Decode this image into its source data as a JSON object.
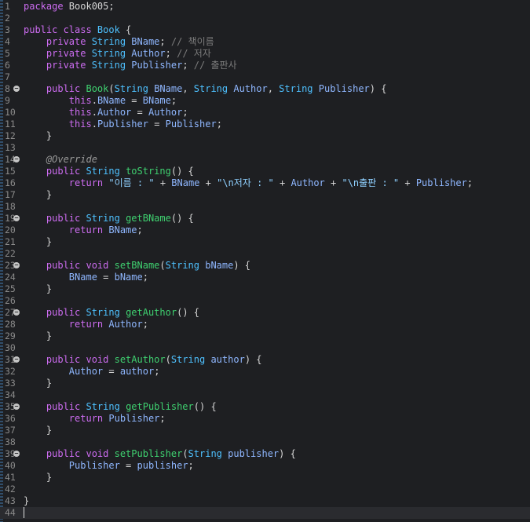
{
  "editor": {
    "lines": [
      {
        "n": "1",
        "fold": false,
        "tokens": [
          [
            "kw",
            "package "
          ],
          [
            "pl",
            "Book005;"
          ]
        ]
      },
      {
        "n": "2",
        "fold": false,
        "tokens": []
      },
      {
        "n": "3",
        "fold": false,
        "tokens": [
          [
            "kw",
            "public class "
          ],
          [
            "typ",
            "Book"
          ],
          [
            "pl",
            " {"
          ]
        ]
      },
      {
        "n": "4",
        "fold": false,
        "tokens": [
          [
            "pl",
            "    "
          ],
          [
            "kw",
            "private "
          ],
          [
            "typ",
            "String "
          ],
          [
            "fld",
            "BName"
          ],
          [
            "pl",
            "; "
          ],
          [
            "cmt",
            "// 책이름"
          ]
        ]
      },
      {
        "n": "5",
        "fold": false,
        "tokens": [
          [
            "pl",
            "    "
          ],
          [
            "kw",
            "private "
          ],
          [
            "typ",
            "String "
          ],
          [
            "fld",
            "Author"
          ],
          [
            "pl",
            "; "
          ],
          [
            "cmt",
            "// 저자"
          ]
        ]
      },
      {
        "n": "6",
        "fold": false,
        "tokens": [
          [
            "pl",
            "    "
          ],
          [
            "kw",
            "private "
          ],
          [
            "typ",
            "String "
          ],
          [
            "fld",
            "Publisher"
          ],
          [
            "pl",
            "; "
          ],
          [
            "cmt",
            "// 출판사"
          ]
        ]
      },
      {
        "n": "7",
        "fold": false,
        "tokens": []
      },
      {
        "n": "8",
        "fold": true,
        "tokens": [
          [
            "pl",
            "    "
          ],
          [
            "kw",
            "public "
          ],
          [
            "fn",
            "Book"
          ],
          [
            "pl",
            "("
          ],
          [
            "typ",
            "String "
          ],
          [
            "fld",
            "BName"
          ],
          [
            "pl",
            ", "
          ],
          [
            "typ",
            "String "
          ],
          [
            "fld",
            "Author"
          ],
          [
            "pl",
            ", "
          ],
          [
            "typ",
            "String "
          ],
          [
            "fld",
            "Publisher"
          ],
          [
            "pl",
            ") {"
          ]
        ]
      },
      {
        "n": "9",
        "fold": false,
        "tokens": [
          [
            "pl",
            "        "
          ],
          [
            "kw",
            "this"
          ],
          [
            "pl",
            "."
          ],
          [
            "fld",
            "BName"
          ],
          [
            "pl",
            " = "
          ],
          [
            "fld",
            "BName"
          ],
          [
            "pl",
            ";"
          ]
        ]
      },
      {
        "n": "10",
        "fold": false,
        "tokens": [
          [
            "pl",
            "        "
          ],
          [
            "kw",
            "this"
          ],
          [
            "pl",
            "."
          ],
          [
            "fld",
            "Author"
          ],
          [
            "pl",
            " = "
          ],
          [
            "fld",
            "Author"
          ],
          [
            "pl",
            ";"
          ]
        ]
      },
      {
        "n": "11",
        "fold": false,
        "tokens": [
          [
            "pl",
            "        "
          ],
          [
            "kw",
            "this"
          ],
          [
            "pl",
            "."
          ],
          [
            "fld",
            "Publisher"
          ],
          [
            "pl",
            " = "
          ],
          [
            "fld",
            "Publisher"
          ],
          [
            "pl",
            ";"
          ]
        ]
      },
      {
        "n": "12",
        "fold": false,
        "tokens": [
          [
            "pl",
            "    }"
          ]
        ]
      },
      {
        "n": "13",
        "fold": false,
        "tokens": []
      },
      {
        "n": "14",
        "fold": true,
        "tokens": [
          [
            "pl",
            "    "
          ],
          [
            "ann",
            "@Override"
          ]
        ]
      },
      {
        "n": "15",
        "fold": false,
        "tokens": [
          [
            "pl",
            "    "
          ],
          [
            "kw",
            "public "
          ],
          [
            "typ",
            "String "
          ],
          [
            "fn",
            "toString"
          ],
          [
            "pl",
            "() {"
          ]
        ]
      },
      {
        "n": "16",
        "fold": false,
        "tokens": [
          [
            "pl",
            "        "
          ],
          [
            "kw",
            "return "
          ],
          [
            "str",
            "\"이름 : \""
          ],
          [
            "pl",
            " + "
          ],
          [
            "fld",
            "BName"
          ],
          [
            "pl",
            " + "
          ],
          [
            "str",
            "\"\\n저자 : \""
          ],
          [
            "pl",
            " + "
          ],
          [
            "fld",
            "Author"
          ],
          [
            "pl",
            " + "
          ],
          [
            "str",
            "\"\\n출판 : \""
          ],
          [
            "pl",
            " + "
          ],
          [
            "fld",
            "Publisher"
          ],
          [
            "pl",
            ";"
          ]
        ]
      },
      {
        "n": "17",
        "fold": false,
        "tokens": [
          [
            "pl",
            "    }"
          ]
        ]
      },
      {
        "n": "18",
        "fold": false,
        "tokens": []
      },
      {
        "n": "19",
        "fold": true,
        "tokens": [
          [
            "pl",
            "    "
          ],
          [
            "kw",
            "public "
          ],
          [
            "typ",
            "String "
          ],
          [
            "fn",
            "getBName"
          ],
          [
            "pl",
            "() {"
          ]
        ]
      },
      {
        "n": "20",
        "fold": false,
        "tokens": [
          [
            "pl",
            "        "
          ],
          [
            "kw",
            "return "
          ],
          [
            "fld",
            "BName"
          ],
          [
            "pl",
            ";"
          ]
        ]
      },
      {
        "n": "21",
        "fold": false,
        "tokens": [
          [
            "pl",
            "    }"
          ]
        ]
      },
      {
        "n": "22",
        "fold": false,
        "tokens": []
      },
      {
        "n": "23",
        "fold": true,
        "tokens": [
          [
            "pl",
            "    "
          ],
          [
            "kw",
            "public void "
          ],
          [
            "fn",
            "setBName"
          ],
          [
            "pl",
            "("
          ],
          [
            "typ",
            "String "
          ],
          [
            "fld",
            "bName"
          ],
          [
            "pl",
            ") {"
          ]
        ]
      },
      {
        "n": "24",
        "fold": false,
        "tokens": [
          [
            "pl",
            "        "
          ],
          [
            "fld",
            "BName"
          ],
          [
            "pl",
            " = "
          ],
          [
            "fld",
            "bName"
          ],
          [
            "pl",
            ";"
          ]
        ]
      },
      {
        "n": "25",
        "fold": false,
        "tokens": [
          [
            "pl",
            "    }"
          ]
        ]
      },
      {
        "n": "26",
        "fold": false,
        "tokens": []
      },
      {
        "n": "27",
        "fold": true,
        "tokens": [
          [
            "pl",
            "    "
          ],
          [
            "kw",
            "public "
          ],
          [
            "typ",
            "String "
          ],
          [
            "fn",
            "getAuthor"
          ],
          [
            "pl",
            "() {"
          ]
        ]
      },
      {
        "n": "28",
        "fold": false,
        "tokens": [
          [
            "pl",
            "        "
          ],
          [
            "kw",
            "return "
          ],
          [
            "fld",
            "Author"
          ],
          [
            "pl",
            ";"
          ]
        ]
      },
      {
        "n": "29",
        "fold": false,
        "tokens": [
          [
            "pl",
            "    }"
          ]
        ]
      },
      {
        "n": "30",
        "fold": false,
        "tokens": []
      },
      {
        "n": "31",
        "fold": true,
        "tokens": [
          [
            "pl",
            "    "
          ],
          [
            "kw",
            "public void "
          ],
          [
            "fn",
            "setAuthor"
          ],
          [
            "pl",
            "("
          ],
          [
            "typ",
            "String "
          ],
          [
            "fld",
            "author"
          ],
          [
            "pl",
            ") {"
          ]
        ]
      },
      {
        "n": "32",
        "fold": false,
        "tokens": [
          [
            "pl",
            "        "
          ],
          [
            "fld",
            "Author"
          ],
          [
            "pl",
            " = "
          ],
          [
            "fld",
            "author"
          ],
          [
            "pl",
            ";"
          ]
        ]
      },
      {
        "n": "33",
        "fold": false,
        "tokens": [
          [
            "pl",
            "    }"
          ]
        ]
      },
      {
        "n": "34",
        "fold": false,
        "tokens": []
      },
      {
        "n": "35",
        "fold": true,
        "tokens": [
          [
            "pl",
            "    "
          ],
          [
            "kw",
            "public "
          ],
          [
            "typ",
            "String "
          ],
          [
            "fn",
            "getPublisher"
          ],
          [
            "pl",
            "() {"
          ]
        ]
      },
      {
        "n": "36",
        "fold": false,
        "tokens": [
          [
            "pl",
            "        "
          ],
          [
            "kw",
            "return "
          ],
          [
            "fld",
            "Publisher"
          ],
          [
            "pl",
            ";"
          ]
        ]
      },
      {
        "n": "37",
        "fold": false,
        "tokens": [
          [
            "pl",
            "    }"
          ]
        ]
      },
      {
        "n": "38",
        "fold": false,
        "tokens": []
      },
      {
        "n": "39",
        "fold": true,
        "tokens": [
          [
            "pl",
            "    "
          ],
          [
            "kw",
            "public void "
          ],
          [
            "fn",
            "setPublisher"
          ],
          [
            "pl",
            "("
          ],
          [
            "typ",
            "String "
          ],
          [
            "fld",
            "publisher"
          ],
          [
            "pl",
            ") {"
          ]
        ]
      },
      {
        "n": "40",
        "fold": false,
        "tokens": [
          [
            "pl",
            "        "
          ],
          [
            "fld",
            "Publisher"
          ],
          [
            "pl",
            " = "
          ],
          [
            "fld",
            "publisher"
          ],
          [
            "pl",
            ";"
          ]
        ]
      },
      {
        "n": "41",
        "fold": false,
        "tokens": [
          [
            "pl",
            "    }"
          ]
        ]
      },
      {
        "n": "42",
        "fold": false,
        "tokens": []
      },
      {
        "n": "43",
        "fold": false,
        "tokens": [
          [
            "pl",
            "}"
          ]
        ]
      },
      {
        "n": "44",
        "fold": false,
        "tokens": []
      }
    ],
    "current_line": "44",
    "colors": {
      "background": "#1e1f22",
      "keyword": "#cc6cf0",
      "type": "#4ec1ff",
      "function": "#3fd170",
      "field": "#8fb7ff",
      "string": "#8fd0ff",
      "comment": "#7c7c7c"
    }
  }
}
